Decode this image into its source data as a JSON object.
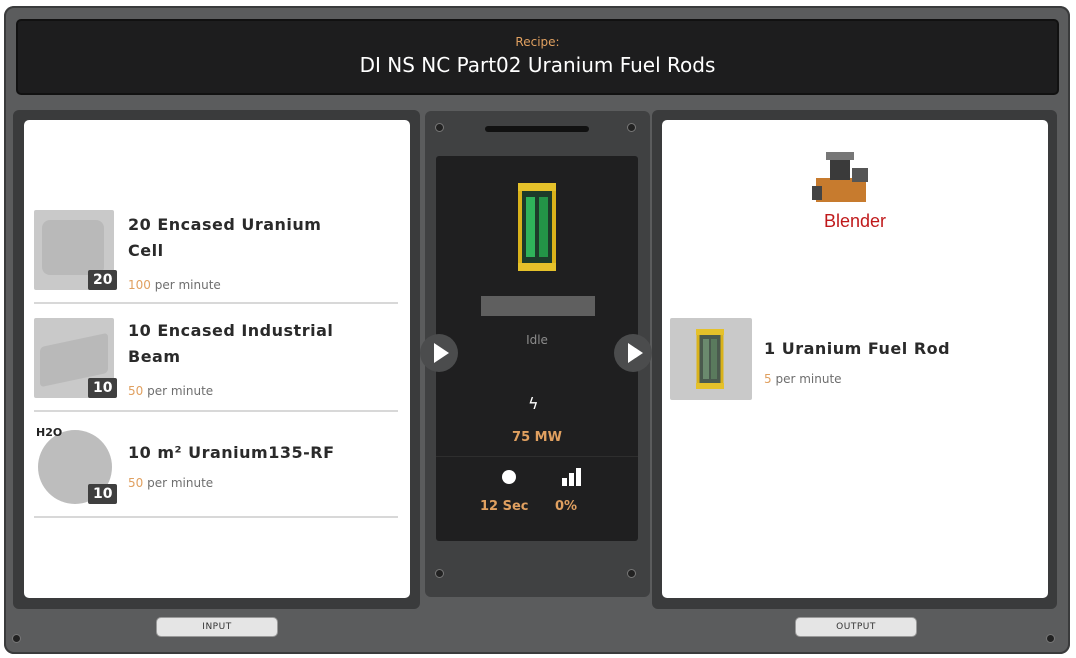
{
  "header": {
    "label": "Recipe:",
    "title": "DI NS NC Part02 Uranium Fuel Rods"
  },
  "inputs": [
    {
      "quantity": "20",
      "name_line1": "20 Encased Uranium",
      "name_line2": "Cell",
      "rate_value": "100",
      "rate_unit": "per minute"
    },
    {
      "quantity": "10",
      "name_line1": "10 Encased Industrial",
      "name_line2": "Beam",
      "rate_value": "50",
      "rate_unit": "per minute"
    },
    {
      "quantity": "10",
      "tag": "H2O",
      "name_line1": "10 m² Uranium135-RF",
      "rate_value": "50",
      "rate_unit": "per minute"
    }
  ],
  "machine": {
    "status": "Idle",
    "power": "75 MW",
    "time": "12 Sec",
    "productivity": "0%"
  },
  "output": {
    "building": "Blender",
    "name": "1 Uranium Fuel Rod",
    "rate_value": "5",
    "rate_unit": "per minute"
  },
  "tabs": {
    "input": "INPUT",
    "output": "OUTPUT"
  },
  "colors": {
    "accent": "#e0a060",
    "building_name": "#c0191b"
  }
}
